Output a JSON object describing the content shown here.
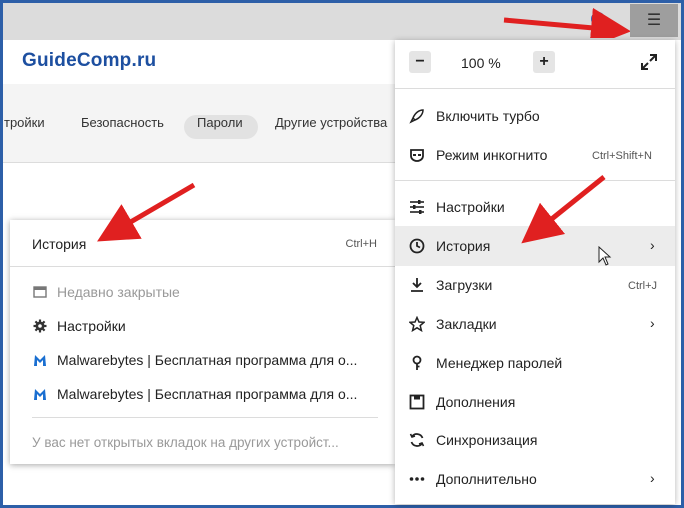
{
  "browser": {
    "menu_icon": "hamburger-icon",
    "logo_text": "GuideComp.ru"
  },
  "settings_tabs": [
    {
      "label": "тройки"
    },
    {
      "label": "Безопасность"
    },
    {
      "label": "Пароли"
    },
    {
      "label": "Другие устройства"
    }
  ],
  "history_submenu": {
    "header": "История",
    "header_shortcut": "Ctrl+H",
    "items": [
      {
        "label": "Недавно закрытые",
        "icon": "window-icon"
      },
      {
        "label": "Настройки",
        "icon": "gear-icon"
      },
      {
        "label": "Malwarebytes | Бесплатная программа для о...",
        "icon": "malwarebytes-icon"
      },
      {
        "label": "Malwarebytes | Бесплатная программа для о...",
        "icon": "malwarebytes-icon"
      }
    ],
    "footer": "У вас нет открытых вкладок на других устройст..."
  },
  "main_menu": {
    "zoom": {
      "minus": "−",
      "value": "100 %",
      "plus": "+"
    },
    "items": [
      {
        "label": "Включить турбо",
        "icon": "rocket-icon",
        "shortcut": ""
      },
      {
        "label": "Режим инкогнито",
        "icon": "incognito-icon",
        "shortcut": "Ctrl+Shift+N"
      },
      {
        "label": "Настройки",
        "icon": "settings-sliders-icon",
        "shortcut": ""
      },
      {
        "label": "История",
        "icon": "clock-icon",
        "shortcut": ""
      },
      {
        "label": "Загрузки",
        "icon": "download-icon",
        "shortcut": "Ctrl+J"
      },
      {
        "label": "Закладки",
        "icon": "star-icon",
        "shortcut": ""
      },
      {
        "label": "Менеджер паролей",
        "icon": "key-icon",
        "shortcut": ""
      },
      {
        "label": "Дополнения",
        "icon": "addons-icon",
        "shortcut": ""
      },
      {
        "label": "Синхронизация",
        "icon": "sync-icon",
        "shortcut": ""
      },
      {
        "label": "Дополнительно",
        "icon": "more-icon",
        "shortcut": ""
      }
    ]
  },
  "colors": {
    "frame": "#2d5fa8",
    "annotation_arrow": "#e02020",
    "highlight": "#ececec"
  }
}
